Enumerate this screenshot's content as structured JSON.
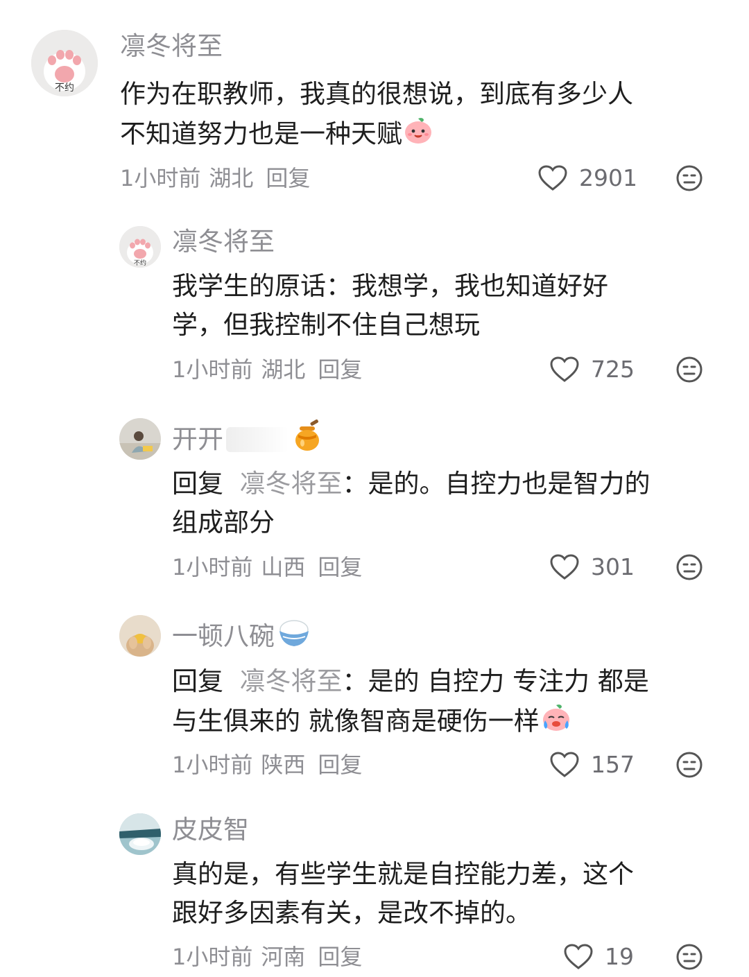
{
  "comments": [
    {
      "nickname": "凛冬将至",
      "text_line1": "作为在职教师，我真的很想说，到底有多少人",
      "text_line2": "不知道努力也是一种天赋",
      "time": "1小时前",
      "location": "湖北",
      "reply_label": "回复",
      "likes": "2901",
      "avatar_text": "不约"
    },
    {
      "nickname": "凛冬将至",
      "text_line1": "我学生的原话：我想学，我也知道好好",
      "text_line2": "学，但我控制不住自己想玩",
      "time": "1小时前",
      "location": "湖北",
      "reply_label": "回复",
      "likes": "725",
      "avatar_text": "不约"
    },
    {
      "nickname": "开开",
      "reply_prefix": "回复",
      "reply_target": "凛冬将至",
      "text_line1_rest": "：是的。自控力也是智力的",
      "text_line2": "组成部分",
      "time": "1小时前",
      "location": "山西",
      "reply_label": "回复",
      "likes": "301"
    },
    {
      "nickname": "一顿八碗",
      "reply_prefix": "回复",
      "reply_target": "凛冬将至",
      "text_line1_rest": "：是的 自控力 专注力 都是",
      "text_line2": "与生俱来的 就像智商是硬伤一样",
      "time": "1小时前",
      "location": "陕西",
      "reply_label": "回复",
      "likes": "157"
    },
    {
      "nickname": "皮皮智",
      "text_line1": "真的是，有些学生就是自控能力差，这个",
      "text_line2": "跟好多因素有关，是改不掉的。",
      "time": "1小时前",
      "location": "河南",
      "reply_label": "回复",
      "likes": "19"
    }
  ],
  "icons": {
    "like": "heart-outline-icon",
    "dislike": "meh-face-icon"
  },
  "colors": {
    "nickname": "#8e8e93",
    "text": "#1e1e1e",
    "meta": "#8e8e93"
  }
}
